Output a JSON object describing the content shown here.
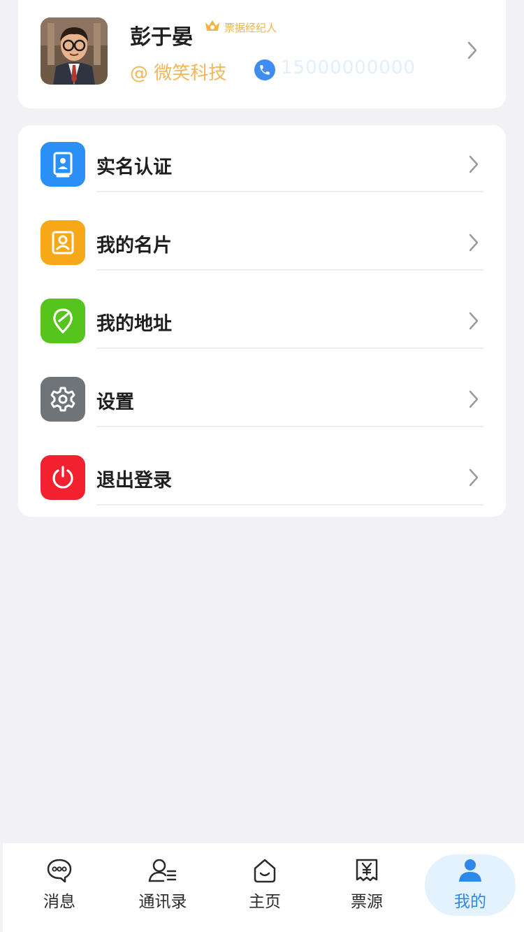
{
  "profile": {
    "name": "彭于晏",
    "role": "票据经纪人",
    "company": "@ 微笑科技",
    "phone": "15000000000"
  },
  "menu": [
    {
      "label": "实名认证",
      "icon": "id-card-icon",
      "color": "#2b8ff3"
    },
    {
      "label": "我的名片",
      "icon": "contact-card-icon",
      "color": "#f6a818"
    },
    {
      "label": "我的地址",
      "icon": "location-pin-icon",
      "color": "#55c41c"
    },
    {
      "label": "设置",
      "icon": "gear-icon",
      "color": "#6f7478"
    },
    {
      "label": "退出登录",
      "icon": "power-icon",
      "color": "#f2212f"
    }
  ],
  "tabs": [
    {
      "label": "消息",
      "icon": "chat-bubble-icon"
    },
    {
      "label": "通讯录",
      "icon": "contacts-icon"
    },
    {
      "label": "主页",
      "icon": "home-icon"
    },
    {
      "label": "票源",
      "icon": "bill-yuan-icon"
    },
    {
      "label": "我的",
      "icon": "user-icon",
      "active": true
    }
  ],
  "colors": {
    "background": "#f1f1f6",
    "accent": "#2f87e8",
    "role_gold": "#f0b24a"
  }
}
